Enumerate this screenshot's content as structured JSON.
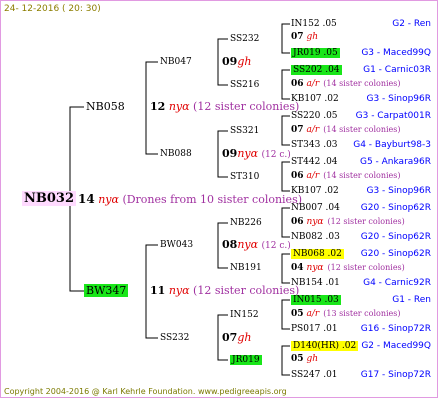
{
  "date": "24- 12-2016 ( 20: 30)",
  "copyright": "Copyright 2004-2016 @ Karl Kehrle Foundation.    www.pedigreeapis.org",
  "root": {
    "name": "NB032",
    "num": "14",
    "race": "nyα",
    "note": "(Drones from 10 sister colonies)"
  },
  "gen1": [
    {
      "name": "NB058",
      "num": "12",
      "race": "nyα",
      "note": "(12 sister colonies)"
    },
    {
      "name": "BW347",
      "num": "11",
      "race": "nyα",
      "note": "(12 sister colonies)"
    }
  ],
  "gen2": [
    {
      "name": "NB047",
      "num": "09",
      "race": "gh",
      "note": ""
    },
    {
      "name": "NB088",
      "num": "09",
      "race": "nyα",
      "note": "(12 c.)"
    },
    {
      "name": "BW043",
      "num": "08",
      "race": "nyα",
      "note": "(12 c.)"
    },
    {
      "name": "SS232",
      "num": "07",
      "race": "gh",
      "note": ""
    }
  ],
  "gen3": [
    "SS232",
    "SS216",
    "SS321",
    "ST310",
    "NB226",
    "NB191",
    "IN152",
    "JR019"
  ],
  "gen4": [
    {
      "name": "IN152 .05",
      "num": "",
      "race": "",
      "note": "",
      "code": "G2 - Ren",
      "hl": ""
    },
    {
      "name": "07",
      "num": "",
      "race": "gh",
      "note": "",
      "code": "",
      "hl": ""
    },
    {
      "name": "JR019 .05",
      "num": "",
      "race": "",
      "note": "",
      "code": "G3 - Maced99Q",
      "hl": "green"
    },
    {
      "name": "SS202 .04",
      "num": "",
      "race": "",
      "note": "",
      "code": "G1 - Carnic03R",
      "hl": "green"
    },
    {
      "name": "06",
      "num": "",
      "race": "a/r",
      "note": "(14 sister colonies)",
      "code": "",
      "hl": ""
    },
    {
      "name": "KB107 .02",
      "num": "",
      "race": "",
      "note": "",
      "code": "G3 - Sinop96R",
      "hl": ""
    },
    {
      "name": "SS220 .05",
      "num": "",
      "race": "",
      "note": "",
      "code": "G3 - Carpat001R",
      "hl": ""
    },
    {
      "name": "07",
      "num": "",
      "race": "a/r",
      "note": "(14 sister colonies)",
      "code": "",
      "hl": ""
    },
    {
      "name": "ST343 .03",
      "num": "",
      "race": "",
      "note": "",
      "code": "G4 - Bayburt98-3",
      "hl": ""
    },
    {
      "name": "ST442 .04",
      "num": "",
      "race": "",
      "note": "",
      "code": "G5 - Ankara96R",
      "hl": ""
    },
    {
      "name": "06",
      "num": "",
      "race": "a/r",
      "note": "(14 sister colonies)",
      "code": "",
      "hl": ""
    },
    {
      "name": "KB107 .02",
      "num": "",
      "race": "",
      "note": "",
      "code": "G3 - Sinop96R",
      "hl": ""
    },
    {
      "name": "NB007 .04",
      "num": "",
      "race": "",
      "note": "",
      "code": "G20 - Sinop62R",
      "hl": ""
    },
    {
      "name": "06",
      "num": "",
      "race": "nyα",
      "note": "(12 sister colonies)",
      "code": "",
      "hl": ""
    },
    {
      "name": "NB082 .03",
      "num": "",
      "race": "",
      "note": "",
      "code": "G20 - Sinop62R",
      "hl": ""
    },
    {
      "name": "NB068 .02",
      "num": "",
      "race": "",
      "note": "",
      "code": "G20 - Sinop62R",
      "hl": "yellow"
    },
    {
      "name": "04",
      "num": "",
      "race": "nyα",
      "note": "(12 sister colonies)",
      "code": "",
      "hl": ""
    },
    {
      "name": "NB154 .01",
      "num": "",
      "race": "",
      "note": "",
      "code": "G4 - Carnic92R",
      "hl": ""
    },
    {
      "name": "IN015 .03",
      "num": "",
      "race": "",
      "note": "",
      "code": "G1 - Ren",
      "hl": "green"
    },
    {
      "name": "05",
      "num": "",
      "race": "a/r",
      "note": "(13 sister colonies)",
      "code": "",
      "hl": ""
    },
    {
      "name": "PS017 .01",
      "num": "",
      "race": "",
      "note": "",
      "code": "G16 - Sinop72R",
      "hl": ""
    },
    {
      "name": "D140(HR) .02",
      "num": "",
      "race": "",
      "note": "",
      "code": "G2 - Maced99Q",
      "hl": "yellow"
    },
    {
      "name": "05",
      "num": "",
      "race": "gh",
      "note": "",
      "code": "",
      "hl": ""
    },
    {
      "name": "SS247 .01",
      "num": "",
      "race": "",
      "note": "",
      "code": "G17 - Sinop72R",
      "hl": ""
    }
  ],
  "colors": {
    "frame": "#e19ae1",
    "root_bg": "#ffdaff",
    "green": "#19e619",
    "yellow": "#ffff00",
    "race": "#e00000",
    "note": "#a030a0",
    "code": "#0000ff"
  }
}
